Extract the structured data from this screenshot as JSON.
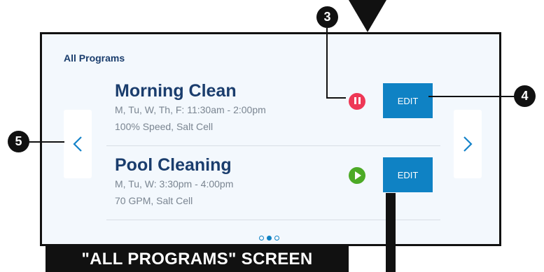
{
  "screen": {
    "title": "All Programs",
    "prev_icon": "chevron-left-icon",
    "next_icon": "chevron-right-icon",
    "page_indicator": {
      "total": 3,
      "active": 2
    },
    "programs": [
      {
        "name": "Morning Clean",
        "schedule": "M, Tu, W, Th, F: 11:30am - 2:00pm",
        "details": "100% Speed, Salt Cell",
        "status_icon": "pause-icon",
        "status_color": "#ee3856",
        "edit_label": "EDIT"
      },
      {
        "name": "Pool Cleaning",
        "schedule": "M, Tu, W: 3:30pm - 4:00pm",
        "details": "70 GPM, Salt Cell",
        "status_icon": "play-icon",
        "status_color": "#4caa26",
        "edit_label": "EDIT"
      }
    ]
  },
  "callouts": {
    "c3": "3",
    "c4": "4",
    "c5": "5"
  },
  "banner": "\"ALL PROGRAMS\" SCREEN",
  "colors": {
    "accent": "#0f82c4",
    "heading": "#1a3d6d",
    "background": "#f3f8fd"
  }
}
